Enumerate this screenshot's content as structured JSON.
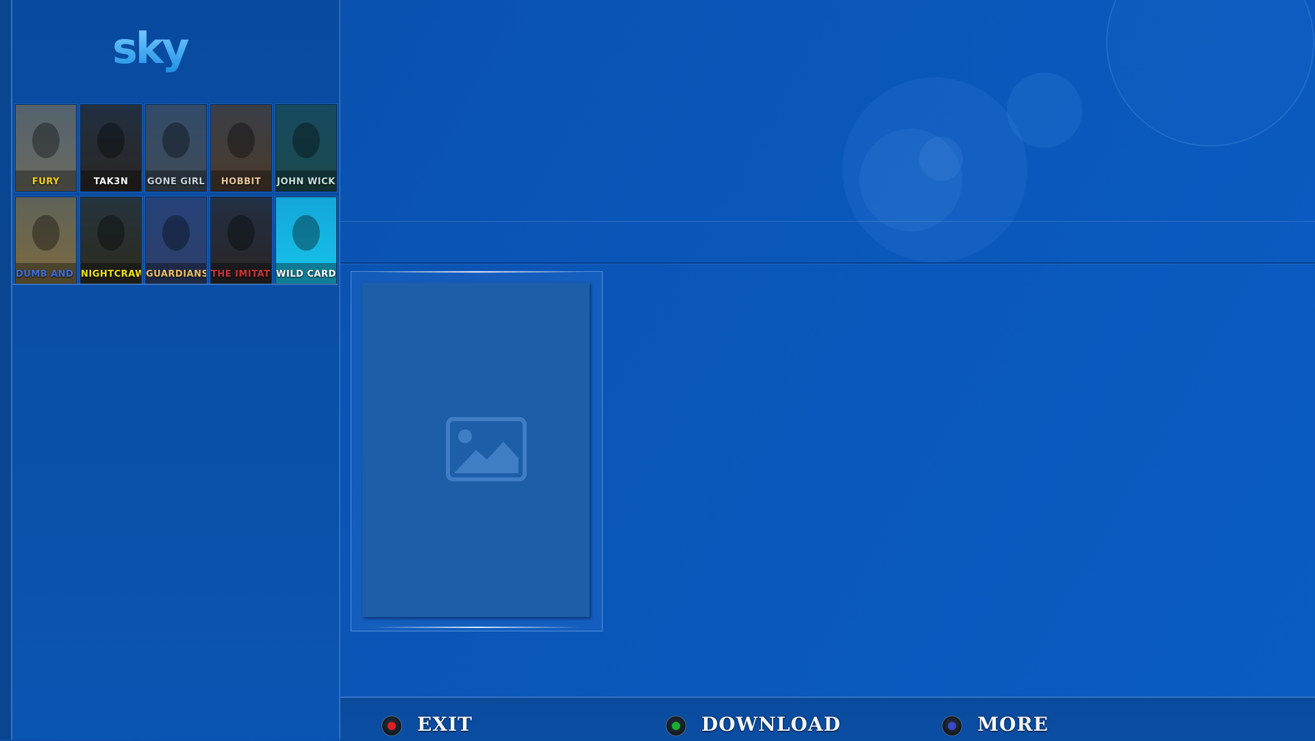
{
  "brand": {
    "logo_text": "sky"
  },
  "posters": [
    {
      "title": "FURY",
      "bg": "#6b6a5e",
      "accent": "#f4d31b"
    },
    {
      "title": "TAK3N",
      "bg": "#2a2622",
      "accent": "#ffffff"
    },
    {
      "title": "GONE GIRL",
      "bg": "#3f4b57",
      "accent": "#c9d3dc"
    },
    {
      "title": "HOBBIT",
      "bg": "#4b3a2a",
      "accent": "#e7c89a"
    },
    {
      "title": "JOHN WICK",
      "bg": "#1c4a4b",
      "accent": "#c6e1dd"
    },
    {
      "title": "DUMB AND DUMBER TO",
      "bg": "#7c6a3f",
      "accent": "#3a6fe0"
    },
    {
      "title": "NIGHTCRAWLER",
      "bg": "#2e2b1c",
      "accent": "#f3e21a"
    },
    {
      "title": "GUARDIANS OF THE GALAXY",
      "bg": "#2f3f6b",
      "accent": "#f0c060"
    },
    {
      "title": "THE IMITATION GAME",
      "bg": "#2a2524",
      "accent": "#cc3333"
    },
    {
      "title": "WILD CARD",
      "bg": "#17c4ea",
      "accent": "#ffffff"
    }
  ],
  "footer": {
    "exit_label": "EXIT",
    "download_label": "DOWNLOAD",
    "more_label": "MORE"
  },
  "colors": {
    "background": "#0a56b8",
    "sidebar": "#0a4fa8",
    "exit_dot": "#e02020",
    "download_dot": "#18b030",
    "more_dot": "#3848c8"
  }
}
